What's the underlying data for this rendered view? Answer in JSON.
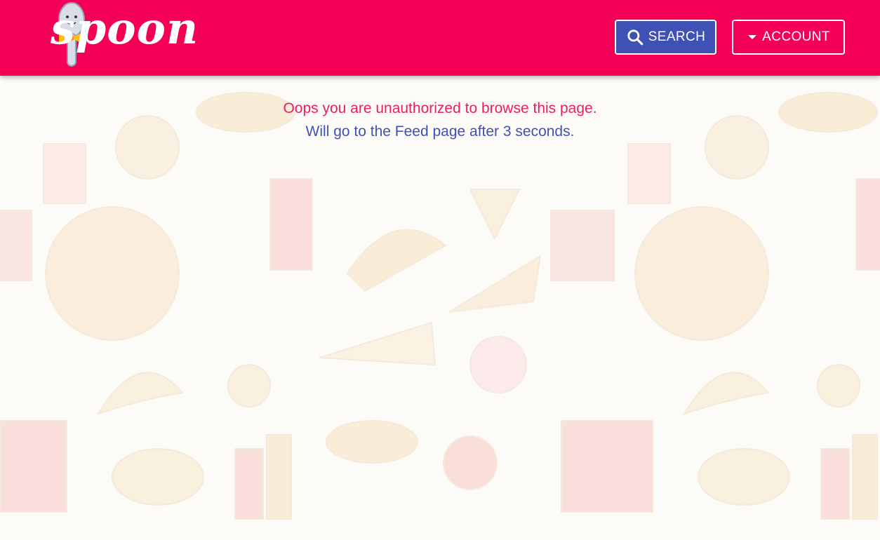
{
  "app": {
    "logo_text": "spoon",
    "brand_color": "#f50057",
    "primary_color": "#3f51b5"
  },
  "header": {
    "search_label": "SEARCH",
    "search_icon": "search-icon",
    "account_label": "ACCOUNT",
    "account_icon": "caret-down-icon"
  },
  "message": {
    "error": "Oops you are unauthorized to browse this page.",
    "redirect": "Will go to the Feed page after 3 seconds."
  }
}
